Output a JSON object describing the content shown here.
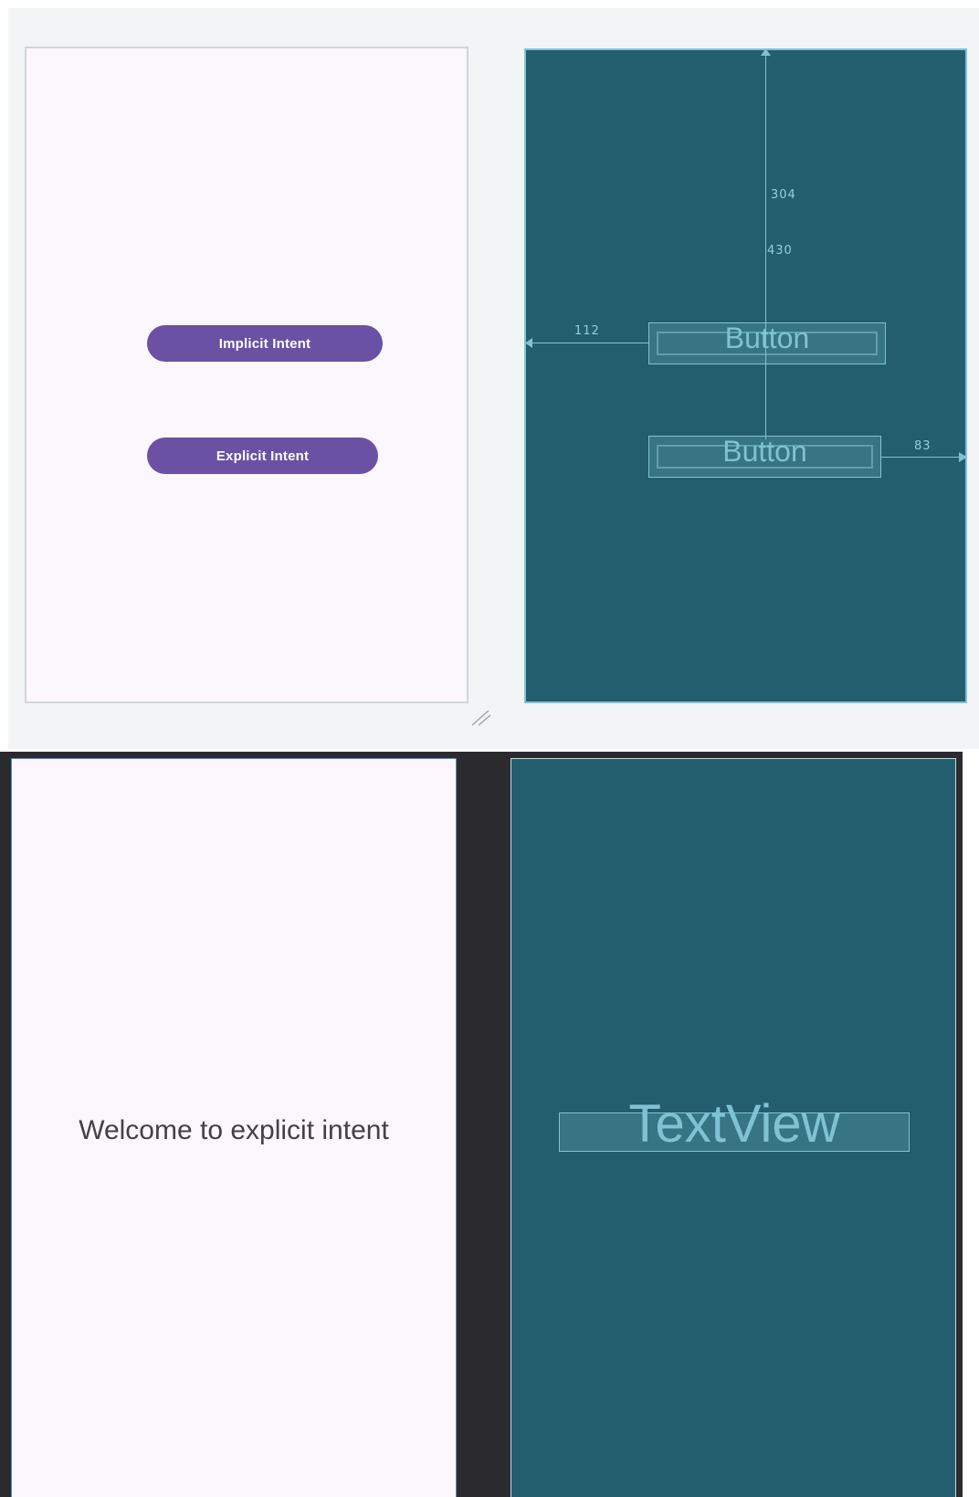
{
  "top_layout": {
    "design": {
      "buttons": [
        {
          "label": "Implicit Intent"
        },
        {
          "label": "Explicit Intent"
        }
      ]
    },
    "blueprint": {
      "buttons": [
        {
          "label": "Button"
        },
        {
          "label": "Button"
        }
      ],
      "dimensions": {
        "top_margin_a": "304",
        "top_margin_b": "430",
        "left_margin": "112",
        "right_margin": "83"
      }
    }
  },
  "bottom_layout": {
    "design": {
      "text": "Welcome to explicit intent"
    },
    "blueprint": {
      "textview_label": "TextView"
    }
  },
  "colors": {
    "button_purple": "#6a51a3",
    "phone_background": "#fcf6fd",
    "blueprint_background": "#235e6f",
    "blueprint_stroke": "#7fc3d3",
    "dark_editor": "#2b2b2f"
  },
  "icons": {
    "resize_handle": "resize-handle-icon"
  }
}
